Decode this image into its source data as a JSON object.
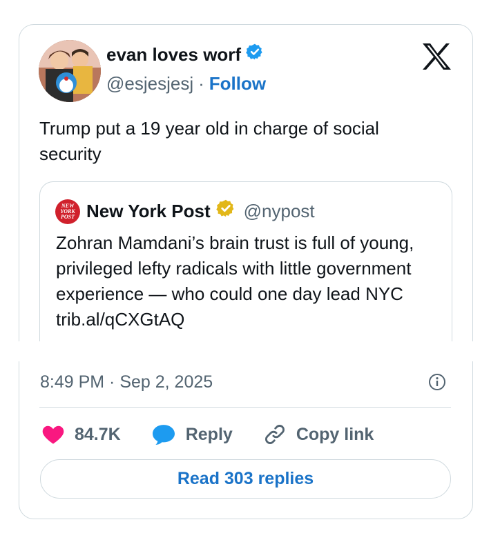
{
  "author": {
    "name": "evan loves worf",
    "handle": "@esjesjesj",
    "separator": "·",
    "follow_label": "Follow"
  },
  "tweet": {
    "text": "Trump put a 19 year old in charge of social security"
  },
  "quote": {
    "name": "New York Post",
    "handle": "@nypost",
    "logo_text_lines": [
      "NEW",
      "YORK",
      "POST"
    ],
    "text": "Zohran Mamdani’s brain trust is full of young, privileged lefty radicals with little government experience — who could one day lead NYC trib.al/qCXGtAQ"
  },
  "timestamp": "8:49 PM · Sep 2, 2025",
  "actions": {
    "like_count": "84.7K",
    "reply_label": "Reply",
    "copy_link_label": "Copy link"
  },
  "read_replies_label": "Read 303 replies",
  "colors": {
    "accent": "#1a73c8",
    "verified_blue": "#1d9bf0",
    "verified_gold": "#e2b719",
    "like_pink": "#f91880",
    "reply_blue": "#1d9bf0",
    "muted": "#536471",
    "border": "#cfd9de"
  },
  "icons": [
    "x-logo-icon",
    "verified-badge-icon",
    "gold-verified-badge-icon",
    "heart-icon",
    "reply-bubble-icon",
    "link-icon",
    "info-icon"
  ]
}
